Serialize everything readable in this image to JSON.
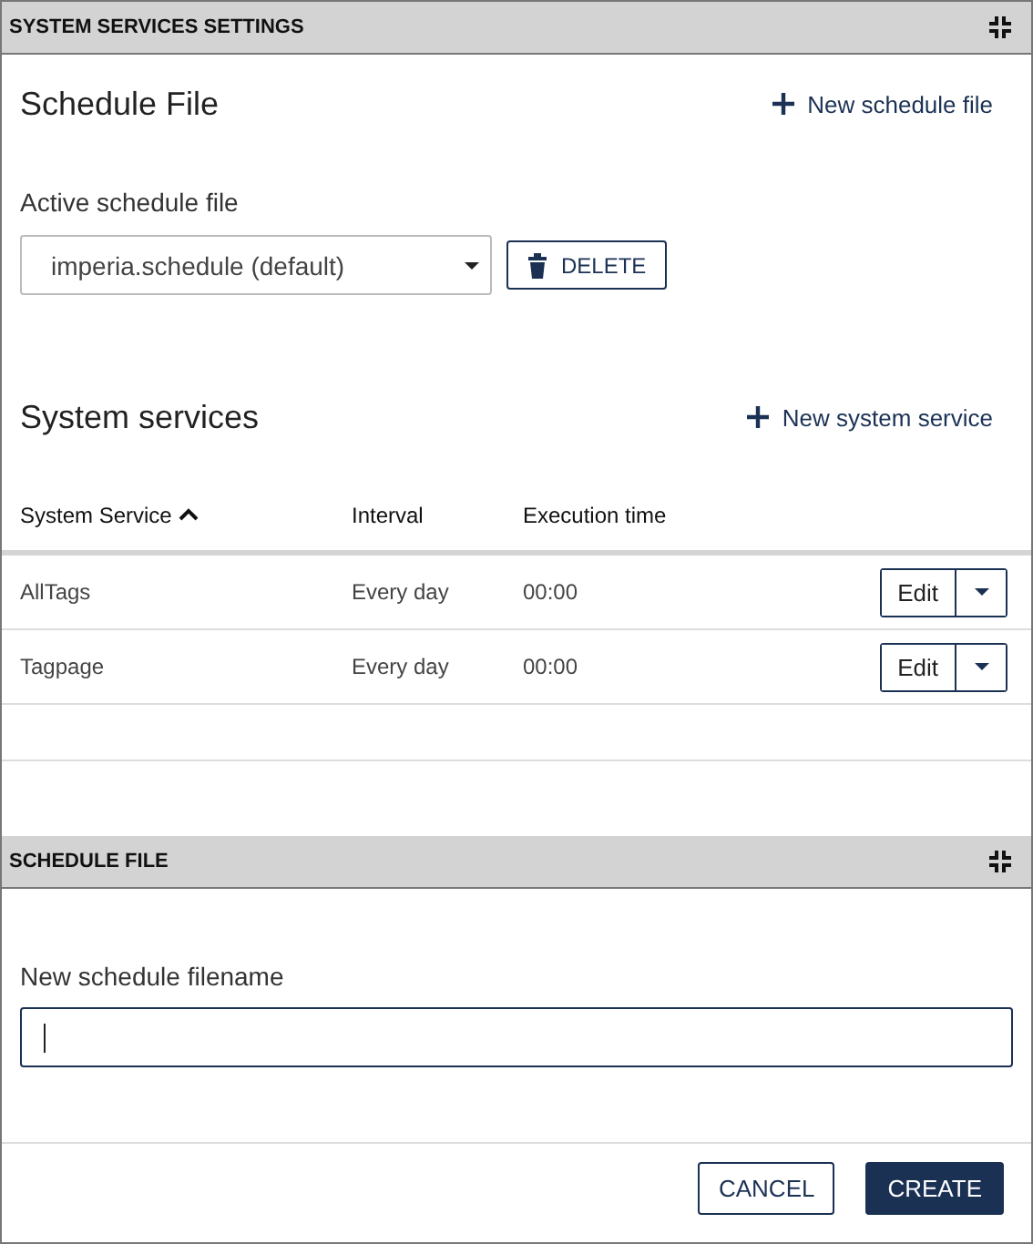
{
  "settings_panel": {
    "title": "SYSTEM SERVICES SETTINGS",
    "schedule_file": {
      "heading": "Schedule File",
      "new_link": "New schedule file",
      "field_label": "Active schedule file",
      "select_value": "imperia.schedule (default)",
      "delete_button": "DELETE"
    },
    "services": {
      "heading": "System services",
      "new_link": "New system service",
      "columns": [
        {
          "label": "System Service",
          "sorted": true
        },
        {
          "label": "Interval",
          "sorted": false
        },
        {
          "label": "Execution time",
          "sorted": false
        }
      ],
      "rows": [
        {
          "service": "AllTags",
          "interval": "Every day",
          "time": "00:00",
          "edit_button": "Edit"
        },
        {
          "service": "Tagpage",
          "interval": "Every day",
          "time": "00:00",
          "edit_button": "Edit"
        }
      ]
    }
  },
  "schedule_file_panel": {
    "title": "SCHEDULE FILE",
    "field_label": "New schedule filename",
    "focused": true,
    "buttons": [
      {
        "label": "CANCEL",
        "kind": "secondary"
      },
      {
        "label": "CREATE",
        "kind": "primary"
      }
    ]
  }
}
